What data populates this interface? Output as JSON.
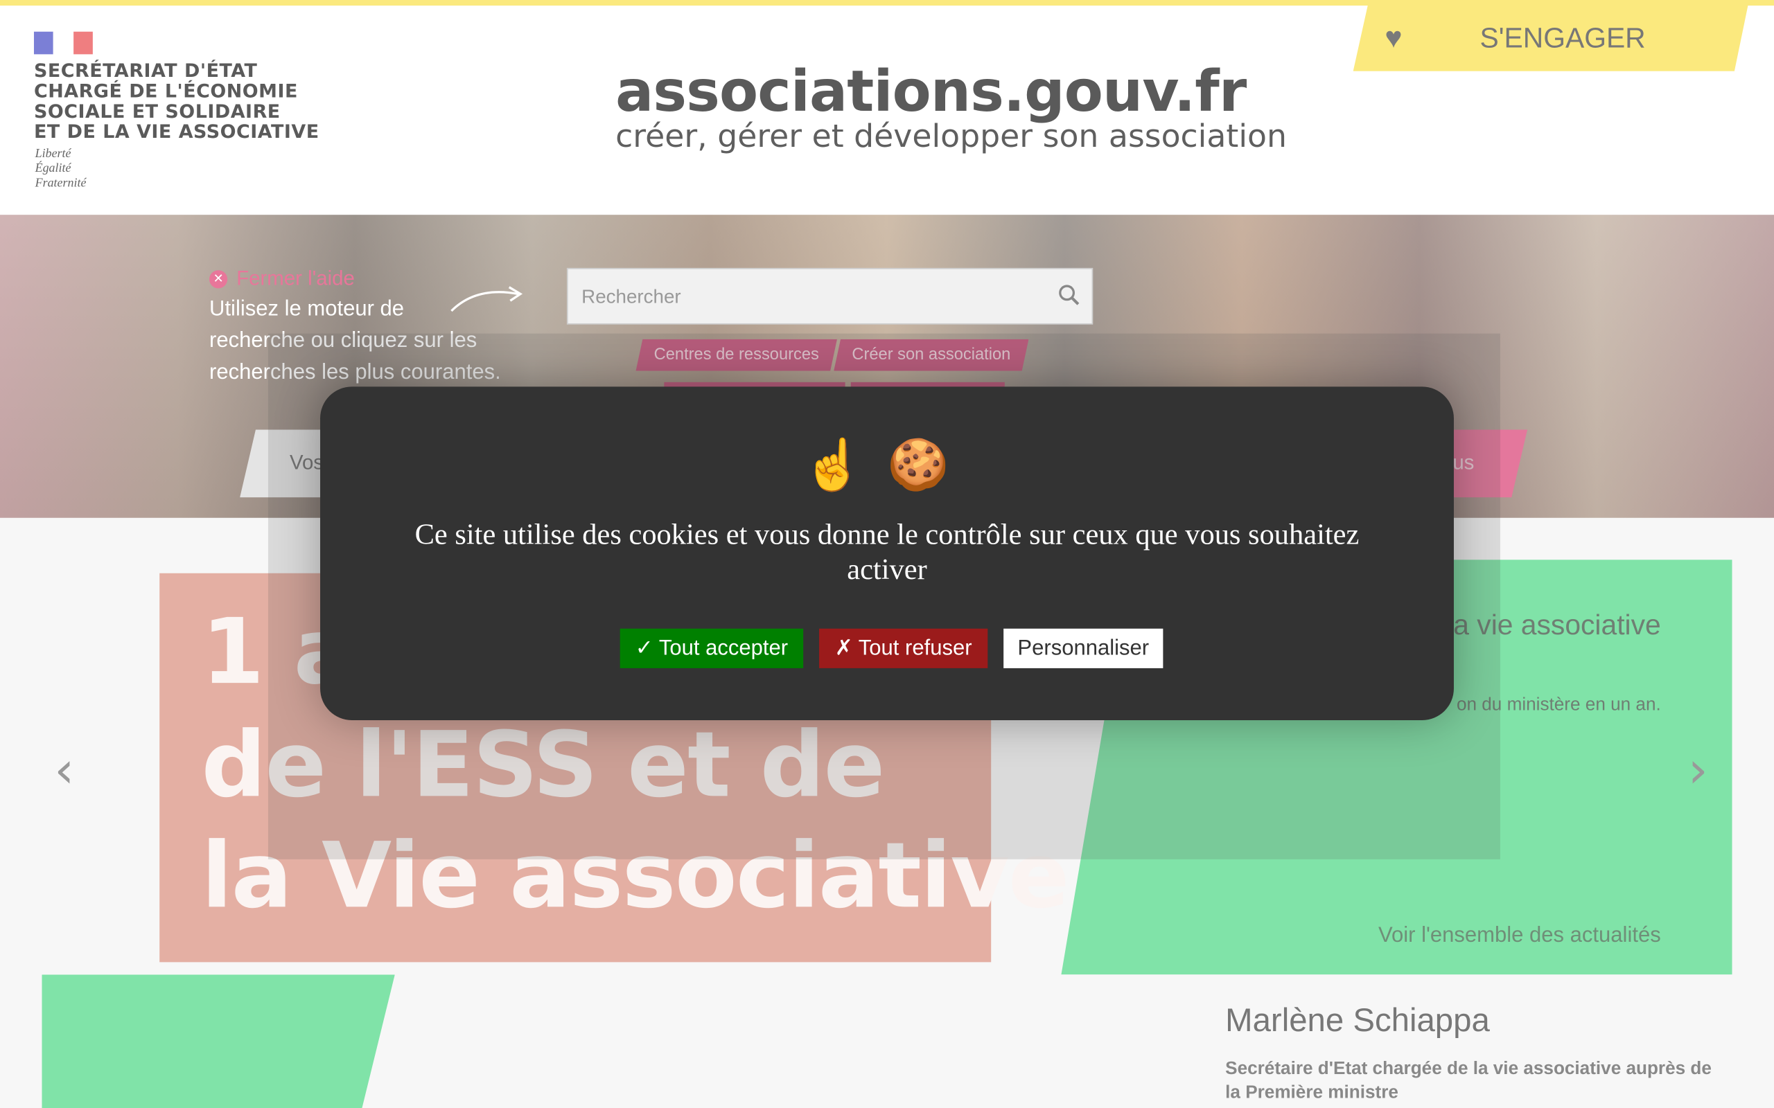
{
  "header": {
    "ministry_lines": [
      "SECRÉTARIAT D'ÉTAT",
      "CHARGÉ DE L'ÉCONOMIE",
      "SOCIALE ET SOLIDAIRE",
      "ET DE LA VIE ASSOCIATIVE"
    ],
    "motto": [
      "Liberté",
      "Égalité",
      "Fraternité"
    ],
    "site_title": "associations.gouv.fr",
    "site_subtitle": "créer, gérer et développer son association",
    "engage_label": "S'ENGAGER",
    "engage_icon": "heart-icon"
  },
  "hero": {
    "close_help": "Fermer l'aide",
    "help_lines": [
      "Utilisez le moteur de",
      "recherche ou cliquez sur les",
      "recherches les plus courantes."
    ],
    "search_placeholder": "Rechercher",
    "tags": [
      "Centres de ressources",
      "Créer son association"
    ],
    "nav_left_partial": "Vos",
    "nav_right_partial": "us"
  },
  "slide": {
    "lines": [
      "1 an",
      "de l'ESS et de",
      "la Vie associative"
    ]
  },
  "news": {
    "title": "action pour la vie associative",
    "description": "on du ministère en un an.",
    "link": "Voir l'ensemble des actualités"
  },
  "minister": {
    "name": "Marlène Schiappa",
    "role": "Secrétaire d'Etat chargée de la vie associative auprès de la Première ministre"
  },
  "cookie_modal": {
    "emojis": "☝️🍪",
    "text": "Ce site utilise des cookies et vous donne le contrôle sur ceux que vous souhaitez activer",
    "accept": "✓ Tout accepter",
    "refuse": "✗ Tout refuser",
    "customize": "Personnaliser"
  },
  "colors": {
    "yellow": "#fbe97e",
    "pink": "#c85c82",
    "green": "#80e3a8",
    "accept": "#008000",
    "refuse": "#9b1b1b"
  }
}
